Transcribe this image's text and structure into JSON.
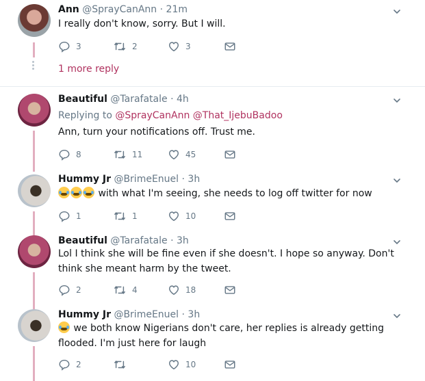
{
  "tweets": [
    {
      "name": "Ann",
      "handle": "@SprayCanAnn",
      "time": "21m",
      "text": "I really don't know, sorry. But I will.",
      "replies": "3",
      "retweets": "2",
      "likes": "3",
      "more_reply": "1 more reply"
    },
    {
      "name": "Beautiful",
      "handle": "@Tarafatale",
      "time": "4h",
      "replying_label": "Replying to",
      "replying_users": [
        "@SprayCanAnn",
        "@That_IjebuBadoo"
      ],
      "text": "Ann, turn your notifications off. Trust me.",
      "replies": "8",
      "retweets": "11",
      "likes": "45"
    },
    {
      "name": "Hummy Jr",
      "handle": "@BrimeEnuel",
      "time": "3h",
      "text": "with what I'm seeing, she needs to log off twitter for now",
      "replies": "1",
      "retweets": "1",
      "likes": "10"
    },
    {
      "name": "Beautiful",
      "handle": "@Tarafatale",
      "time": "3h",
      "text": "Lol I think she will be fine even if she doesn't. I hope so anyway. Don't think she meant harm by the tweet.",
      "replies": "2",
      "retweets": "4",
      "likes": "18"
    },
    {
      "name": "Hummy Jr",
      "handle": "@BrimeEnuel",
      "time": "3h",
      "text": "we both know Nigerians don't care, her replies is already getting flooded. I'm just here for laugh",
      "replies": "2",
      "retweets": "",
      "likes": "10"
    }
  ],
  "separator": "·",
  "colors": {
    "link": "#b0325f",
    "muted": "#657786",
    "thread_line": "#e2aebf"
  },
  "icons": [
    "reply-icon",
    "retweet-icon",
    "like-icon",
    "message-icon",
    "chevron-down-icon",
    "joy-emoji"
  ]
}
